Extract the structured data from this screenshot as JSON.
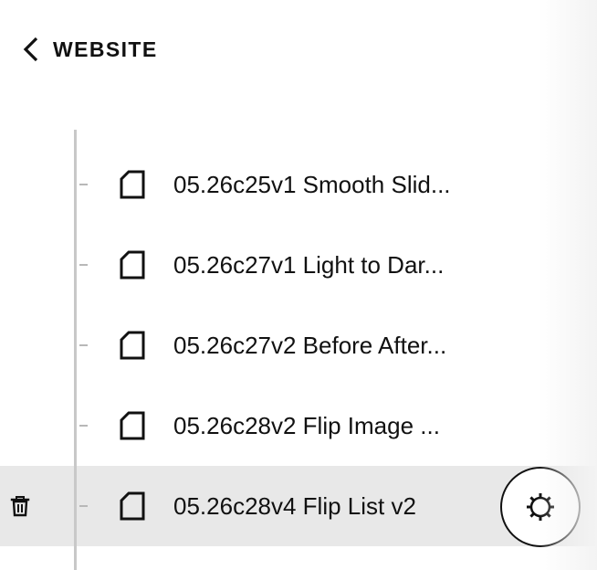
{
  "header": {
    "back_label": "WEBSITE"
  },
  "pages": {
    "items": [
      {
        "label": "05.26c25v1 Smooth Slid..."
      },
      {
        "label": "05.26c27v1 Light to Dar..."
      },
      {
        "label": "05.26c27v2 Before After..."
      },
      {
        "label": "05.26c28v2 Flip Image ..."
      },
      {
        "label": "05.26c28v4 Flip List v2",
        "selected": true
      }
    ]
  },
  "icons": {
    "back": "chevron-left-icon",
    "page": "page-icon",
    "delete": "trash-icon",
    "settings": "gear-icon"
  },
  "colors": {
    "text": "#111111",
    "selected_row_background": "#e8e8e8",
    "tree_line": "#c8c8c8"
  }
}
